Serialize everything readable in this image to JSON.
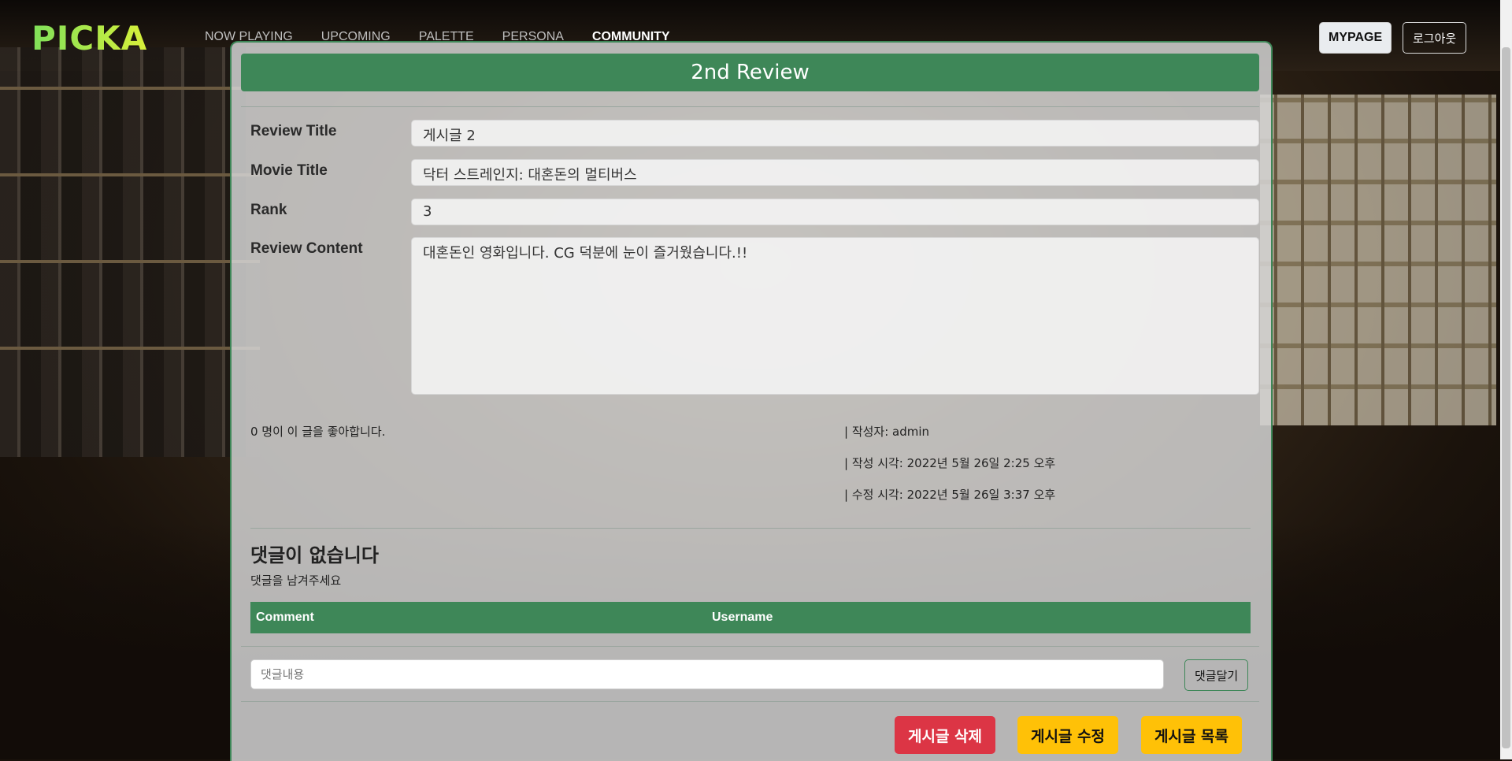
{
  "nav": {
    "logo": "PICKA",
    "menu": [
      "NOW PLAYING",
      "UPCOMING",
      "PALETTE",
      "PERSONA",
      "COMMUNITY"
    ],
    "active_index": 4,
    "mypage": "MYPAGE",
    "logout": "로그아웃"
  },
  "review": {
    "heading": "2nd Review",
    "labels": {
      "title": "Review Title",
      "movie": "Movie Title",
      "rank": "Rank",
      "content": "Review Content"
    },
    "values": {
      "title": "게시글 2",
      "movie": "닥터 스트레인지: 대혼돈의 멀티버스",
      "rank": "3",
      "content": "대혼돈인 영화입니다. CG 덕분에 눈이 즐거웠습니다.!!"
    },
    "likes": "0 명이 이 글을 좋아합니다.",
    "author": "| 작성자: admin",
    "created": "| 작성 시각: 2022년 5월 26일 2:25 오후",
    "updated": "| 수정 시각: 2022년 5월 26일 3:37 오후"
  },
  "comments": {
    "empty_title": "댓글이 없습니다",
    "empty_sub": "댓글을 남겨주세요",
    "col_comment": "Comment",
    "col_username": "Username",
    "input_placeholder": "댓글내용",
    "submit": "댓글달기"
  },
  "actions": {
    "delete": "게시글 삭제",
    "edit": "게시글 수정",
    "list": "게시글 목록"
  },
  "colors": {
    "accent": "#3e8758",
    "danger": "#dc3545",
    "warning": "#ffc107"
  }
}
